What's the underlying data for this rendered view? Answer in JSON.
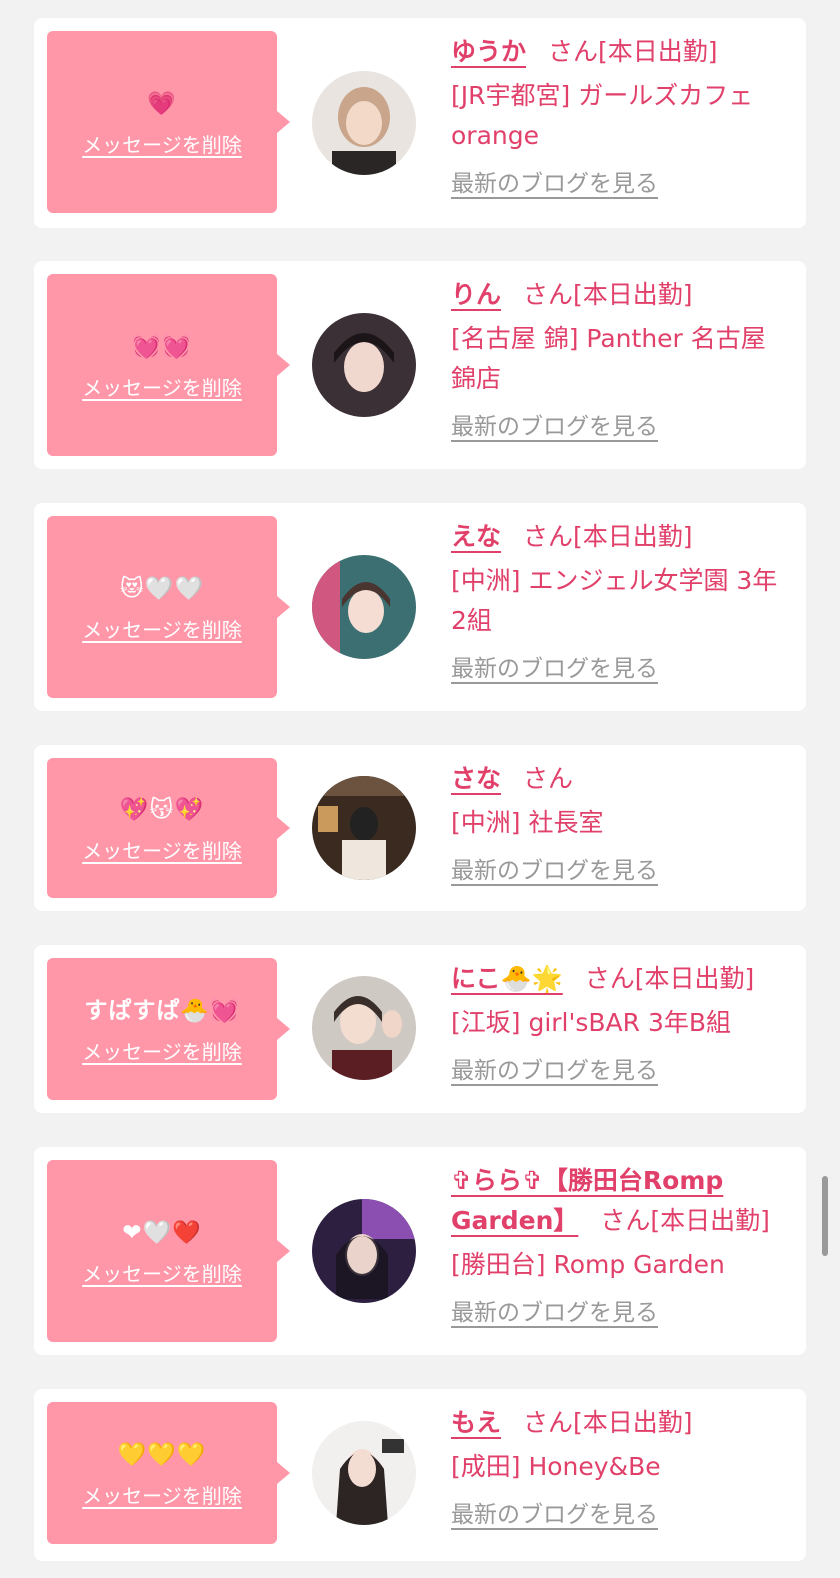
{
  "colors": {
    "accent": "#e1406a",
    "message_box": "#ff97a9",
    "muted": "#999999",
    "background": "#f2f2f2"
  },
  "delete_label": "メッセージを削除",
  "blog_label": "最新のブログを見る",
  "san_label": "さん",
  "cards": [
    {
      "message": "💗",
      "name": "ゆうか",
      "status": "[本日出勤]",
      "shop": "[JR宇都宮] ガールズカフェorange",
      "show_blog": true
    },
    {
      "message": "💓💓",
      "name": "りん",
      "status": "[本日出勤]",
      "shop": "[名古屋 錦] Panther 名古屋錦店",
      "show_blog": true
    },
    {
      "message": "😻🤍🤍",
      "name": "えな",
      "status": "[本日出勤]",
      "shop": "[中洲] エンジェル女学園 3年2組",
      "show_blog": true
    },
    {
      "message": "💖😽💖",
      "name": "さな",
      "status": "",
      "shop": "[中洲] 社長室",
      "show_blog": true
    },
    {
      "message": "すぱすぱ🐣💓",
      "name": "にこ🐣🌟",
      "status": "[本日出勤]",
      "shop": "[江坂] girl'sBAR 3年B組",
      "show_blog": true
    },
    {
      "message": "❤🤍❤️",
      "name": "✞らら✞【勝田台Romp Garden】",
      "status": "[本日出勤]",
      "shop": "[勝田台] Romp Garden",
      "show_blog": true
    },
    {
      "message": "💛💛💛",
      "name": "もえ",
      "status": "[本日出勤]",
      "shop": "[成田] Honey&Be",
      "show_blog": true
    }
  ]
}
